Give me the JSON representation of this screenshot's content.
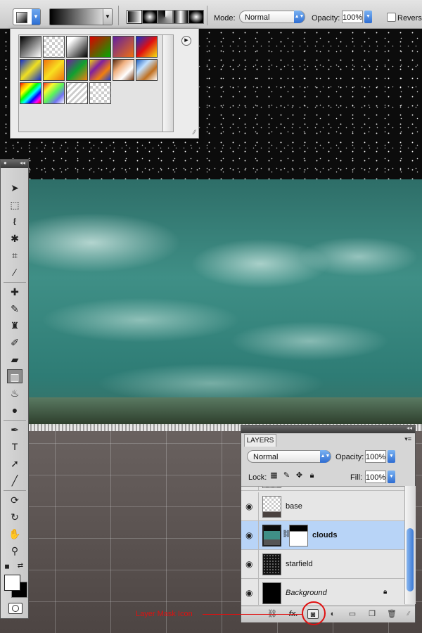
{
  "options_bar": {
    "mode_label": "Mode:",
    "mode_value": "Normal",
    "opacity_label": "Opacity:",
    "opacity_value": "100%",
    "reverse_label": "Reverse",
    "gradient_types": [
      "linear",
      "radial",
      "angle",
      "reflected",
      "diamond"
    ],
    "active_gradient_type": "linear"
  },
  "gradient_popup": {
    "presets": [
      "black-white",
      "transparent-checker",
      "black-white-diagonal",
      "red-green",
      "violet-orange",
      "blue-red-yellow",
      "blue-yellow-blue",
      "orange-yellow-orange",
      "violet-green-orange",
      "yellow-violet-orange-blue",
      "copper",
      "chrome",
      "spectrum",
      "transparent-rainbow",
      "transparent-stripes",
      "checker"
    ]
  },
  "tools": {
    "items": [
      "move",
      "marquee",
      "lasso",
      "quick-selection",
      "crop",
      "eyedropper",
      "healing-brush",
      "brush",
      "clone-stamp",
      "history-brush",
      "eraser",
      "gradient",
      "blur",
      "dodge",
      "pen",
      "type",
      "path-selection",
      "line",
      "3d-rotate",
      "3d-orbit",
      "hand",
      "zoom"
    ],
    "active": "gradient",
    "foreground_color": "#ffffff",
    "background_color": "#000000"
  },
  "layers_panel": {
    "tab_label": "LAYERS",
    "blend_mode": "Normal",
    "opacity_label": "Opacity:",
    "opacity_value": "100%",
    "lock_label": "Lock:",
    "fill_label": "Fill:",
    "fill_value": "100%",
    "layers": [
      {
        "name": "base",
        "visible": true,
        "selected": false,
        "italic": false,
        "locked": false
      },
      {
        "name": "clouds",
        "visible": true,
        "selected": true,
        "italic": false,
        "locked": false,
        "has_mask": true
      },
      {
        "name": "starfield",
        "visible": true,
        "selected": false,
        "italic": false,
        "locked": false
      },
      {
        "name": "Background",
        "visible": true,
        "selected": false,
        "italic": true,
        "locked": true
      }
    ],
    "footer_buttons": [
      "link-layers",
      "fx",
      "add-layer-mask",
      "adjustment-layer",
      "new-group",
      "new-layer",
      "delete-layer"
    ]
  },
  "annotation": {
    "label": "Layer Mask Icon",
    "color": "#e01010"
  }
}
